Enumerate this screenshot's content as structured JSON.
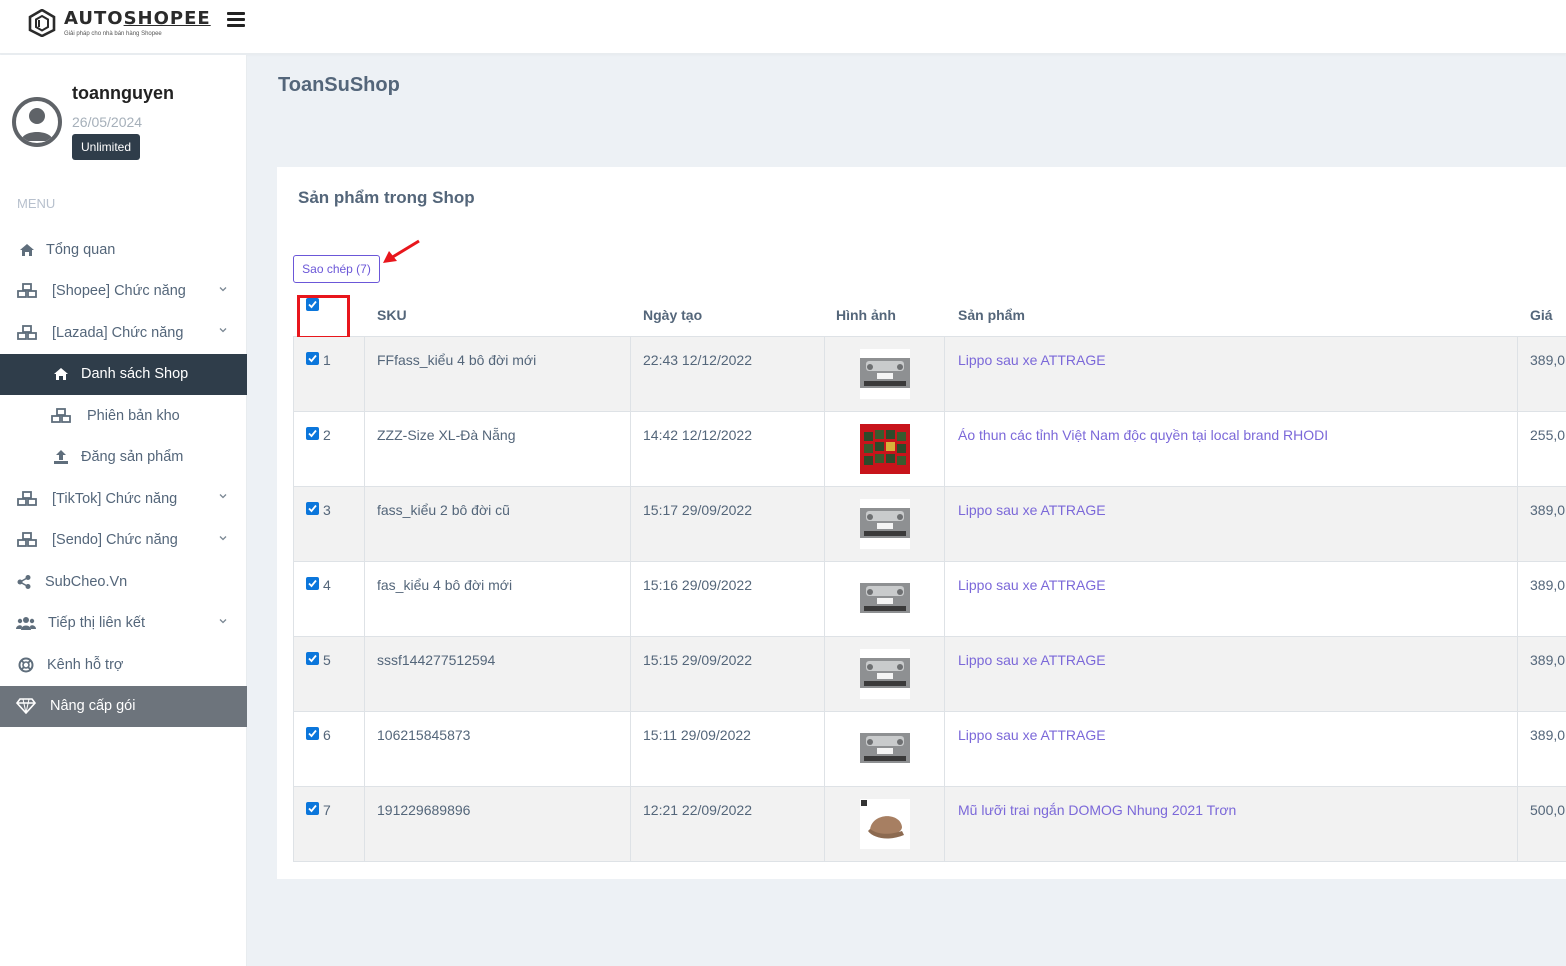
{
  "header": {
    "logo_text_a": "AUTO",
    "logo_text_b": "SHOPEE",
    "logo_tagline": "Giải pháp cho nhà bán hàng Shopee",
    "menu_icon": "hamburger-icon"
  },
  "profile": {
    "username": "toannguyen",
    "date": "26/05/2024",
    "plan": "Unlimited"
  },
  "sidebar": {
    "menu_label": "MENU",
    "items": [
      {
        "label": "Tổng quan",
        "icon": "home-icon"
      },
      {
        "label": "[Shopee] Chức năng",
        "icon": "cubes-icon"
      },
      {
        "label": "[Lazada] Chức năng",
        "icon": "cubes-icon"
      },
      {
        "label": "Danh sách Shop",
        "icon": "home-icon"
      },
      {
        "label": "Phiên bản kho",
        "icon": "cubes-icon"
      },
      {
        "label": "Đăng sản phẩm",
        "icon": "upload-icon"
      },
      {
        "label": "[TikTok] Chức năng",
        "icon": "cubes-icon"
      },
      {
        "label": "[Sendo] Chức năng",
        "icon": "cubes-icon"
      },
      {
        "label": "SubCheo.Vn",
        "icon": "share-icon"
      },
      {
        "label": "Tiếp thị liên kết",
        "icon": "users-icon"
      },
      {
        "label": "Kênh hỗ trợ",
        "icon": "lifebuoy-icon"
      },
      {
        "label": "Nâng cấp gói",
        "icon": "diamond-icon"
      }
    ]
  },
  "page": {
    "title": "ToanSuShop",
    "card_title": "Sản phẩm trong Shop",
    "copy_button": "Sao chép (7)"
  },
  "table": {
    "headers": {
      "sku": "SKU",
      "created": "Ngày tạo",
      "image": "Hình ảnh",
      "product": "Sản phẩm",
      "price": "Giá"
    },
    "rows": [
      {
        "no": "1",
        "sku": "FFfass_kiểu 4 bô đời mới",
        "created": "22:43 12/12/2022",
        "product": "Lippo sau xe ATTRAGE",
        "price": "389,0",
        "image": "car-rear-photo"
      },
      {
        "no": "2",
        "sku": "ZZZ-Size XL-Đà Nẵng",
        "created": "14:42 12/12/2022",
        "product": "Áo thun các tỉnh Việt Nam độc quyền tại local brand RHODI",
        "price": "255,0",
        "image": "tshirt-collage-photo"
      },
      {
        "no": "3",
        "sku": "fass_kiểu 2 bô đời cũ",
        "created": "15:17 29/09/2022",
        "product": "Lippo sau xe ATTRAGE",
        "price": "389,0",
        "image": "car-rear-photo"
      },
      {
        "no": "4",
        "sku": "fas_kiểu 4 bô đời mới",
        "created": "15:16 29/09/2022",
        "product": "Lippo sau xe ATTRAGE",
        "price": "389,0",
        "image": "car-rear-photo"
      },
      {
        "no": "5",
        "sku": "sssf144277512594",
        "created": "15:15 29/09/2022",
        "product": "Lippo sau xe ATTRAGE",
        "price": "389,0",
        "image": "car-rear-photo"
      },
      {
        "no": "6",
        "sku": "106215845873",
        "created": "15:11 29/09/2022",
        "product": "Lippo sau xe ATTRAGE",
        "price": "389,0",
        "image": "car-rear-photo"
      },
      {
        "no": "7",
        "sku": "191229689896",
        "created": "12:21 22/09/2022",
        "product": "Mũ lưỡi trai ngắn DOMOG Nhung 2021 Trơn",
        "price": "500,0",
        "image": "cap-photo"
      }
    ]
  },
  "colors": {
    "accent": "#6b57d8",
    "link": "#7b68d9",
    "sidebar_active": "#2f3d4a",
    "checkbox": "#0b76db",
    "highlight": "#e8161c"
  }
}
